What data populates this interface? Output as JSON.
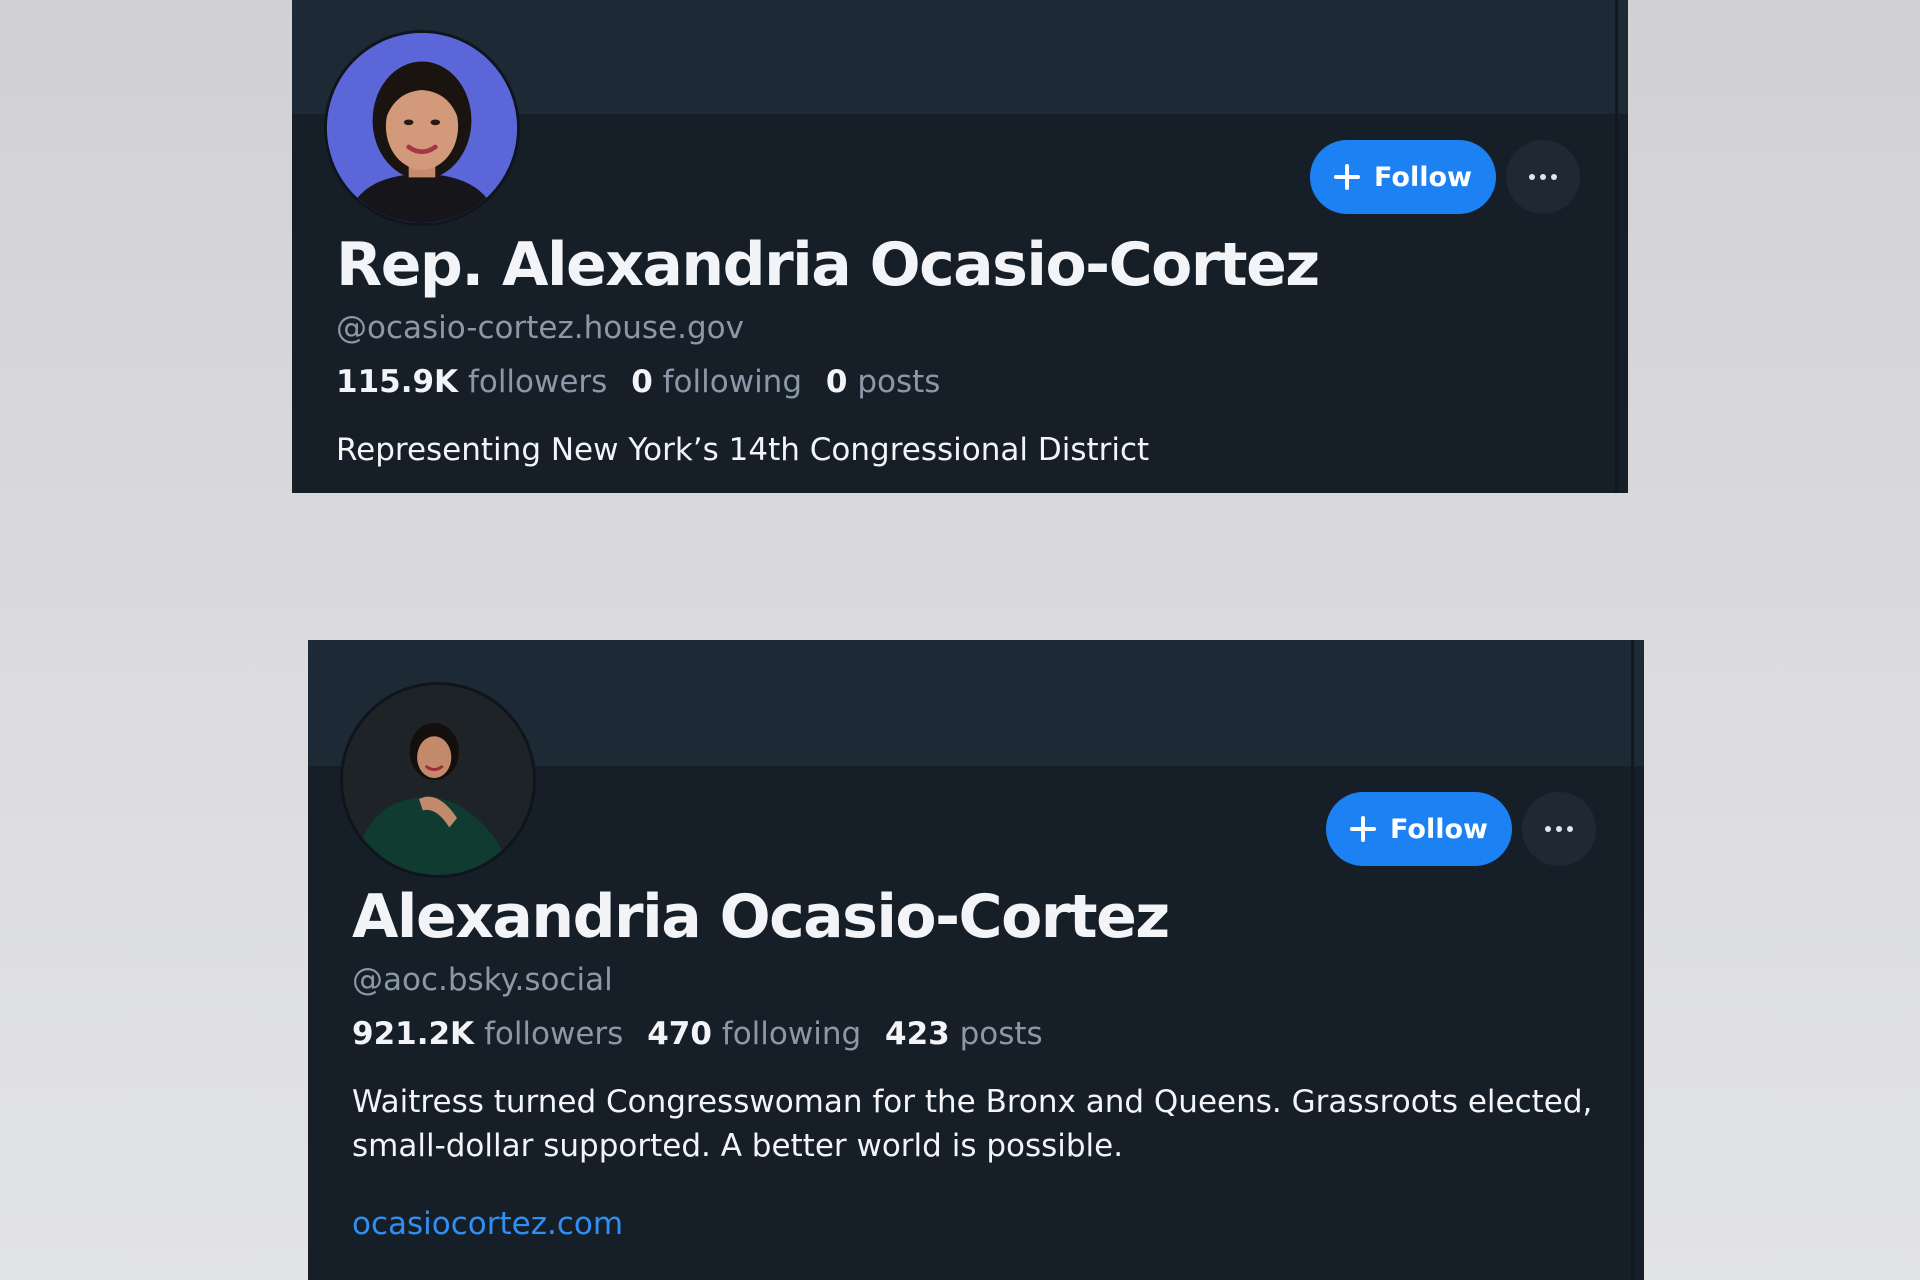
{
  "profiles": [
    {
      "display_name": "Rep. Alexandria Ocasio-Cortez",
      "handle": "@ocasio-cortez.house.gov",
      "followers_count": "115.9K",
      "followers_label": "followers",
      "following_count": "0",
      "following_label": "following",
      "posts_count": "0",
      "posts_label": "posts",
      "bio": "Representing New York’s 14th Congressional District",
      "follow_label": "Follow",
      "more_icon": "ellipsis-icon",
      "follow_icon": "plus-icon"
    },
    {
      "display_name": "Alexandria Ocasio-Cortez",
      "handle": "@aoc.bsky.social",
      "followers_count": "921.2K",
      "followers_label": "followers",
      "following_count": "470",
      "following_label": "following",
      "posts_count": "423",
      "posts_label": "posts",
      "bio": "Waitress turned Congresswoman for the Bronx and Queens. Grassroots elected, small-dollar supported. A better world is possible.",
      "website": "ocasiocortez.com",
      "follow_label": "Follow",
      "more_icon": "ellipsis-icon",
      "follow_icon": "plus-icon"
    }
  ],
  "colors": {
    "page_background": "#d9d9db",
    "card_background": "#161e27",
    "banner_background": "#1e2936",
    "follow_button": "#1c82f4",
    "link": "#2f8ff2",
    "secondary_text": "#8b98a8",
    "primary_text": "#f2f4f7"
  }
}
